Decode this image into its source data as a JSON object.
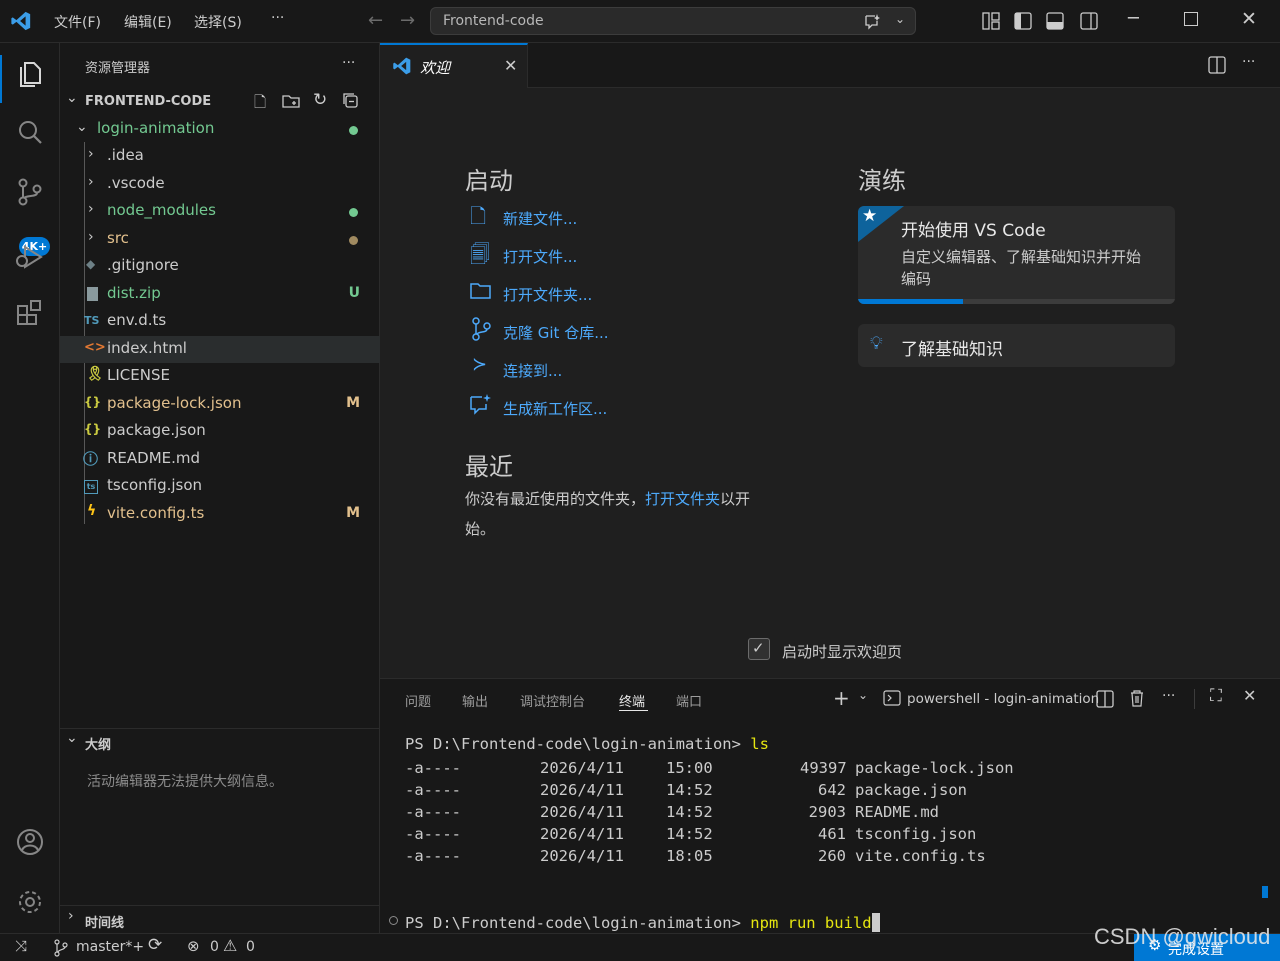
{
  "titlebar": {
    "menus": [
      "文件(F)",
      "编辑(E)",
      "选择(S)",
      "···"
    ],
    "command_center": "Frontend-code"
  },
  "activity": {
    "scm_badge": "4K+"
  },
  "sidebar": {
    "title": "资源管理器",
    "more": "···",
    "root": "FRONTEND-CODE",
    "items": [
      {
        "label": "login-animation",
        "color": "#73c991",
        "deco": "dot-green"
      },
      {
        "label": ".idea",
        "color": "#cccccc"
      },
      {
        "label": ".vscode",
        "color": "#cccccc"
      },
      {
        "label": "node_modules",
        "color": "#73c991",
        "deco": "dot-green"
      },
      {
        "label": "src",
        "color": "#e2c08d",
        "deco": "dot-yellow"
      },
      {
        "label": ".gitignore",
        "color": "#cccccc"
      },
      {
        "label": "dist.zip",
        "color": "#73c991",
        "deco": "U"
      },
      {
        "label": "env.d.ts",
        "color": "#cccccc",
        "icon": "TS"
      },
      {
        "label": "index.html",
        "color": "#cccccc"
      },
      {
        "label": "LICENSE",
        "color": "#cccccc"
      },
      {
        "label": "package-lock.json",
        "color": "#e2c08d",
        "deco": "M"
      },
      {
        "label": "package.json",
        "color": "#cccccc"
      },
      {
        "label": "README.md",
        "color": "#cccccc"
      },
      {
        "label": "tsconfig.json",
        "color": "#cccccc"
      },
      {
        "label": "vite.config.ts",
        "color": "#e2c08d",
        "deco": "M"
      }
    ],
    "outline_title": "大纲",
    "outline_msg": "活动编辑器无法提供大纲信息。",
    "timeline_title": "时间线"
  },
  "editor": {
    "tab_label": "欢迎",
    "start_title": "启动",
    "start_links": [
      "新建文件...",
      "打开文件...",
      "打开文件夹...",
      "克隆 Git 仓库...",
      "连接到...",
      "生成新工作区..."
    ],
    "recent_title": "最近",
    "recent_text_1": "你没有最近使用的文件夹，",
    "recent_link": "打开文件夹",
    "recent_text_2": "以开",
    "recent_text_3": "始。",
    "walk_title": "演练",
    "walk_card_title": "开始使用 VS Code",
    "walk_card_desc_1": "自定义编辑器、了解基础知识并开始",
    "walk_card_desc_2": "编码",
    "walk_card_progress": 0.33,
    "learn_card": "了解基础知识",
    "show_on_startup": "启动时显示欢迎页"
  },
  "panel": {
    "tabs": [
      "问题",
      "输出",
      "调试控制台",
      "终端",
      "端口"
    ],
    "active_tab": "终端",
    "terminal_name": "powershell - login-animation",
    "prompt1": "PS D:\\Frontend-code\\login-animation> ",
    "cmd1": "ls",
    "rows": [
      {
        "mode": "-a----",
        "date": "2026/4/11",
        "time": "15:00",
        "size": "49397",
        "name": "package-lock.json"
      },
      {
        "mode": "-a----",
        "date": "2026/4/11",
        "time": "14:52",
        "size": "642",
        "name": "package.json"
      },
      {
        "mode": "-a----",
        "date": "2026/4/11",
        "time": "14:52",
        "size": "2903",
        "name": "README.md"
      },
      {
        "mode": "-a----",
        "date": "2026/4/11",
        "time": "14:52",
        "size": "461",
        "name": "tsconfig.json"
      },
      {
        "mode": "-a----",
        "date": "2026/4/11",
        "time": "18:05",
        "size": "260",
        "name": "vite.config.ts"
      }
    ],
    "prompt2": "PS D:\\Frontend-code\\login-animation> ",
    "cmd2": "npm run build"
  },
  "status": {
    "branch": "master*+",
    "errors": "0",
    "warnings": "0",
    "notification": "完成设置",
    "watermark": "CSDN @gwicloud"
  },
  "colors": {
    "accent": "#0078d4",
    "link": "#4daafc",
    "modified": "#e2c08d",
    "untracked": "#73c991"
  }
}
